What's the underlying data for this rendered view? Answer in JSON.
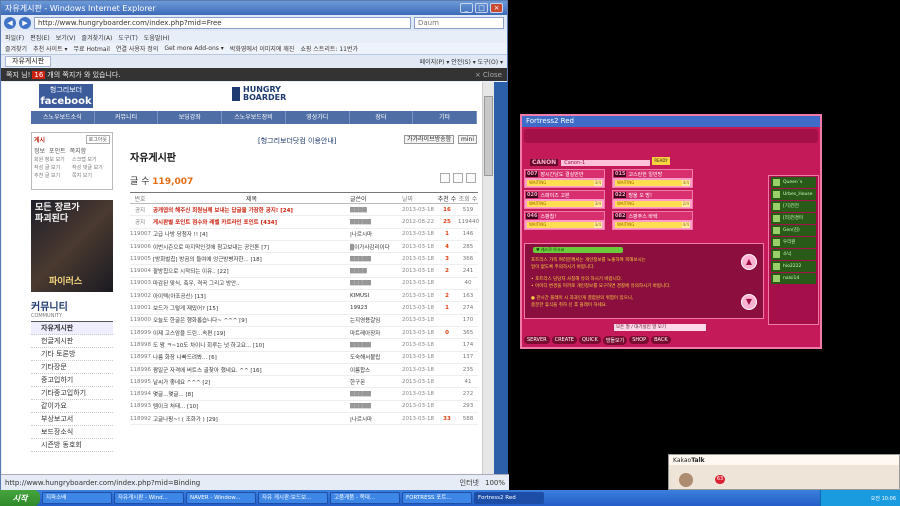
{
  "ie": {
    "title": "자유게시판 - Windows Internet Explorer",
    "address": "http://www.hungryboarder.com/index.php?mid=Free",
    "search_placeholder": "Daum",
    "menu": [
      "파일(F)",
      "편집(E)",
      "보기(V)",
      "즐겨찾기(A)",
      "도구(T)",
      "도움말(H)"
    ],
    "favs": [
      "즐겨찾기",
      "추천 사이트 ▾",
      "무료 Hotmail",
      "연결 사용자 정의",
      "Get more Add-ons ▾",
      "박화영에서 이미지에 깨진",
      "쇼핑 스트리트: 11번가"
    ],
    "tab": "자유게시판",
    "tools": "페이지(P) ▾  안전(S) ▾  도구(O) ▾",
    "status_url": "http://www.hungryboarder.com/index.php?mid=Binding",
    "status_zone": "인터넷",
    "zoom": "100%"
  },
  "notice": {
    "label": "쪽지",
    "pre": "님!",
    "count": "16",
    "post": "개의 쪽지가 와 있습니다.",
    "close": "× Close"
  },
  "site": {
    "fb_top": "헝그리보더",
    "fb_main": "facebook",
    "hb1": "HUNGRY",
    "hb2": "BOARDER",
    "nav": [
      "스노우보드소식",
      "커뮤니티",
      "보딩강좌",
      "스노우보드장비",
      "영상가디",
      "장터",
      "기타"
    ],
    "login_title": "게시",
    "login_btn": "로그아웃",
    "login_links": [
      "정보",
      "포인트",
      "쪽지함"
    ],
    "login_grid": [
      "회원 정보 보기",
      "스크랩 보기",
      "작성 글 보기",
      "작성 댓글 보기",
      "추천 글 보기",
      "쪽지 보기"
    ],
    "banner_line1": "모든 장르가",
    "banner_line2": "파괴된다",
    "banner_sub": "파이러스",
    "community": "커뮤니티",
    "community_en": "COMMUNITY",
    "side_menu": [
      "자유게시판",
      "헌글게시판",
      "기타 토론방",
      "기타장문",
      "중고입하기",
      "기타중고입하기",
      "같이가요",
      "부상보고서",
      "보드장소식",
      "시즌방 동호회"
    ],
    "crumb": "[헝그리보더닷컴 이용안내]",
    "btn_a": "가가라이브방송함",
    "btn_b": "mini",
    "board_title": "자유게시판",
    "total_label": "글 수",
    "total": "119,007"
  },
  "table": {
    "headers": [
      "번호",
      "제목",
      "글쓴이",
      "날짜",
      "추천 수",
      "조회 수"
    ],
    "rows": [
      [
        "공지",
        "공개엽의 해주신 회원님께 보내는 답글을 가장한 공지! [24]",
        "▒▒▒▒",
        "2013-03-18",
        "16",
        "519"
      ],
      [
        "공지",
        "게시판별 포인트 점수와 레벨 카트라인 포인트 [434]",
        "▒▒▒▒▒",
        "2012-08-22",
        "25",
        "119440"
      ],
      [
        "119007",
        "고급 나방 당첨자 !! [4]",
        "|나르시마",
        "2013-03-18",
        "1",
        "146"
      ],
      [
        "119006",
        "이번시즌으로 마지막인것에 참고보내는 공인톤 [7]",
        "▒이가사감리이다",
        "2013-03-18",
        "4",
        "285"
      ],
      [
        "119005",
        "[방화벌칩] 방곰의 들여에 엉근방병자한... [18]",
        "▒▒▒▒▒",
        "2013-03-18",
        "3",
        "366"
      ],
      [
        "119004",
        "팔방힙으로 시작되는 이유.. [22]",
        "▒▒▒▒",
        "2013-03-18",
        "2",
        "241"
      ],
      [
        "119003",
        "마감된 맞식, 축우, 격곡 그리고 방안..",
        "▒▒▒▒▒",
        "2013-03-18",
        "",
        "40"
      ],
      [
        "119002",
        "아이텍(아조공신) [13]",
        "KIMUSI",
        "2013-03-18",
        "2",
        "163"
      ],
      [
        "119001",
        "보드가 그렇게 재밌어? [15]",
        "19923",
        "2013-03-18",
        "1",
        "274"
      ],
      [
        "119000",
        "오늘도 한글은 행화롭습니다~ ^^^ [9]",
        "는지영용갈임",
        "2013-03-18",
        "",
        "170"
      ],
      [
        "118999",
        "이제 고스암을 드린...속편 [19]",
        "마트레아장자",
        "2013-03-18",
        "0",
        "365"
      ],
      [
        "118998",
        "도 왕 ㅋ~10도 차이니 회루는 넛 하고요... [10]",
        "▒▒▒▒▒",
        "2013-03-18",
        "",
        "174"
      ],
      [
        "118997",
        "나름 화장 나빠드려봐... [6]",
        "도숙해서불립",
        "2013-03-18",
        "",
        "137"
      ],
      [
        "118996",
        "짬일군 자격에 버트스 골찾아 했네요. ^^ [16]",
        "이름합스",
        "2013-03-18",
        "",
        "235"
      ],
      [
        "118995",
        "날씨가 좋네요 ^^^ [2]",
        "한구몬",
        "2013-03-18",
        "",
        "41"
      ],
      [
        "118994",
        "몇글...몇글... [8]",
        "▒▒▒▒▒",
        "2013-03-18",
        "",
        "272"
      ],
      [
        "118993",
        "템이크 처태... [10]",
        "▒▒▒▒▒",
        "2013-03-18",
        "",
        "293"
      ],
      [
        "118992",
        "고글나핑~! ( 조화가 ) [29]",
        "|나르시마",
        "2013-03-18",
        "33",
        "588"
      ]
    ]
  },
  "fortress": {
    "title": "Fortress2 Red",
    "name_label": "CANON",
    "name_value": "Canon-1",
    "ready": "READY",
    "slots": [
      {
        "num": "007",
        "title": "장시간낭도 결실만만",
        "status": "WAITING",
        "count": "3/4"
      },
      {
        "num": "015",
        "title": "고스란한 일반방",
        "status": "WAITING",
        "count": "4/4"
      },
      {
        "num": "020",
        "title": "스파이즈 고본",
        "status": "WAITING",
        "count": "3/4"
      },
      {
        "num": "022",
        "title": "방울 오 방!",
        "status": "WAITING",
        "count": "2/4"
      },
      {
        "num": "046",
        "title": "스팡칩!",
        "status": "WAITING",
        "count": "3/4"
      },
      {
        "num": "082",
        "title": "스팡주스 바텍",
        "status": "WAITING",
        "count": "4/4"
      }
    ],
    "chat_header": "♥ 캐스르 아시씨",
    "chat_lines": [
      "포트리스 가족 여러분께서는 개인정보를 노출하여 피해보시는",
      "일이 없도록 주의하시기 바랍니다.",
      "",
      "• 포트리스 담당자 사칭해 유의 하시기 바랍니다.",
      "• 아이디 변경을 미끼로 개인정보를 요구하면 경찰에 유의하시기 바랍니다.",
      "",
      "● 관시간 플레이 시 과과인게 결합원의 위험이 있으니,",
      "   충분한 휴식을 취하 신 후 플레이 하세요."
    ],
    "chat_input": "모든 말 / 대기실인 말 모기",
    "buttons": [
      "SERVER",
      "CREATE",
      "QUICK",
      "방들보기",
      "SHOP",
      "BACK"
    ],
    "users": [
      "Queen´s",
      "Urbes_House",
      "[기]전전",
      "[리]전경미",
      "Gen(김)",
      "우리원",
      "소닉",
      "hio2222",
      "nalsi14"
    ]
  },
  "kakao": {
    "title": "Kakao",
    "title2": "Talk",
    "badge": "63"
  },
  "taskbar": {
    "start": "시작",
    "tasks": [
      "지파소배",
      "자유게시판 - Wind...",
      "NAVER - Window...",
      "자유 게시판:보드보...",
      "고품게품 - 쪽대...",
      "FORTRESS 포트...",
      "Fortress2 Red"
    ],
    "clock": "오전 10:06"
  }
}
